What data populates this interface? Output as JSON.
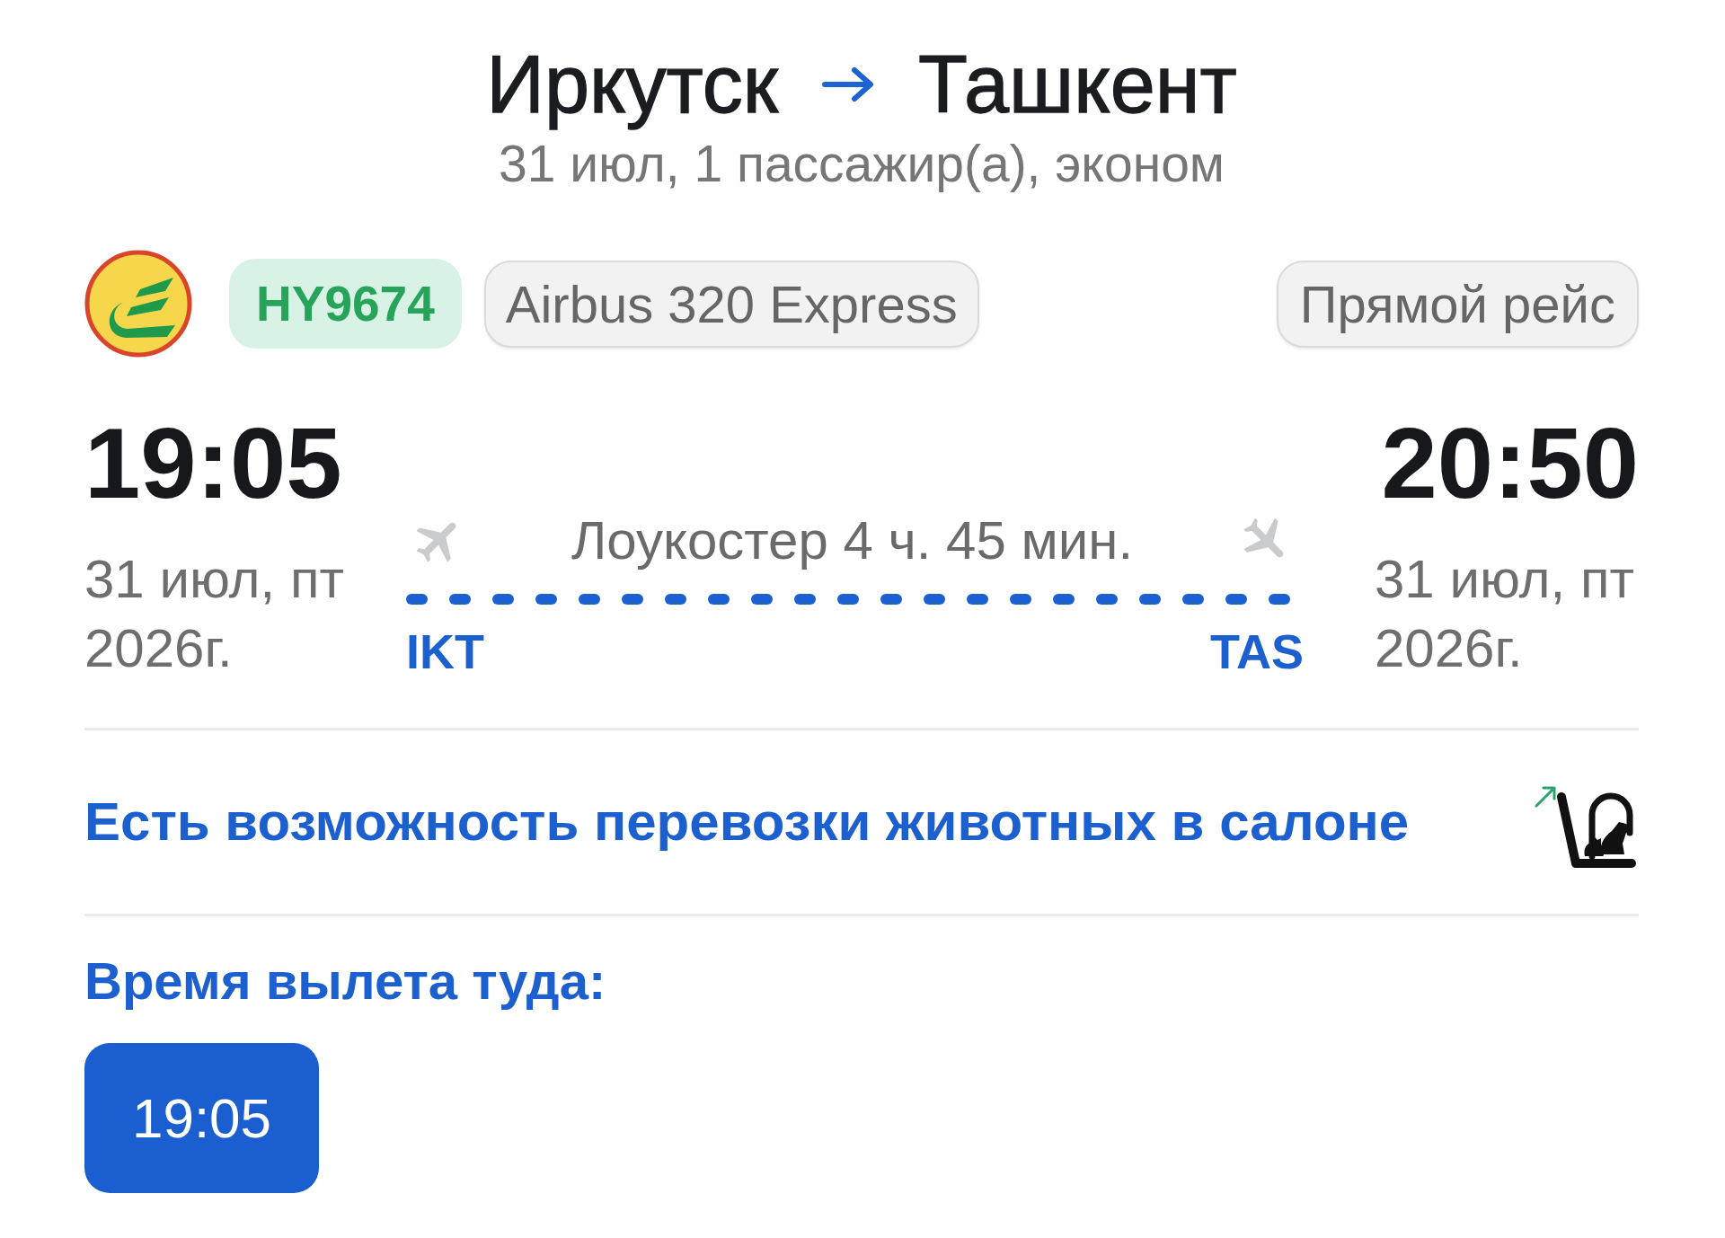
{
  "header": {
    "origin": "Иркутск",
    "destination": "Ташкент",
    "details": "31 июл, 1 пассажир(а), эконом"
  },
  "tags": {
    "flight_number": "HY9674",
    "aircraft": "Airbus 320 Express",
    "route_type": "Прямой рейс"
  },
  "departure": {
    "time": "19:05",
    "date": "31 июл, пт 2026г.",
    "airport": "IKT"
  },
  "segment": {
    "label": "Лоукостер 4 ч. 45 мин."
  },
  "arrival": {
    "time": "20:50",
    "date": "31 июл, пт 2026г.",
    "airport": "TAS"
  },
  "pets": {
    "text": "Есть возможность перевозки животных в салоне"
  },
  "departure_times": {
    "title": "Время вылета туда:",
    "options": [
      {
        "time": "19:05",
        "selected": true
      }
    ]
  }
}
